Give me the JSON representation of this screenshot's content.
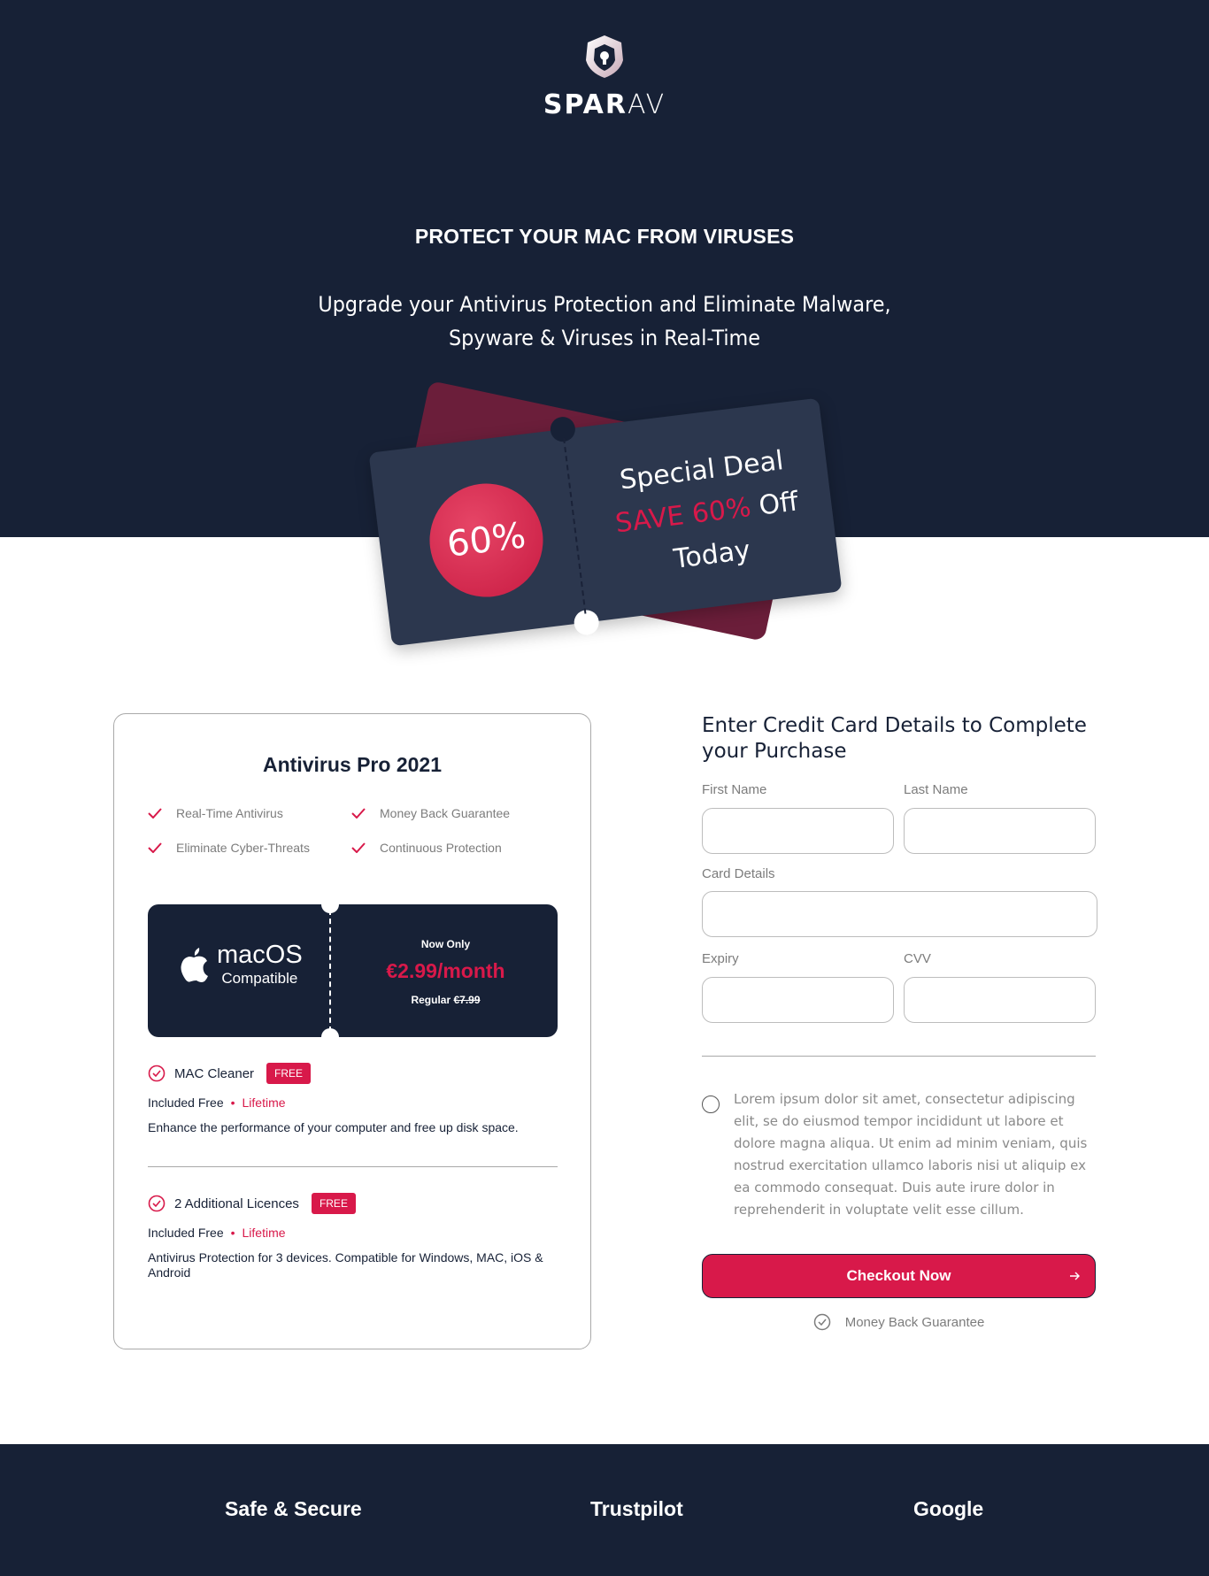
{
  "brand": {
    "name_bold": "SPAR",
    "name_light": "AV",
    "logo_icon": "shield-lock-icon"
  },
  "hero": {
    "headline": "PROTECT YOUR MAC FROM VIRUSES",
    "subhead_line1": "Upgrade your Antivirus Protection and Eliminate Malware,",
    "subhead_line2": "Spyware & Viruses in Real-Time"
  },
  "ticket": {
    "badge": "60%",
    "line1": "Special Deal",
    "save": "SAVE 60%",
    "off": "Off",
    "line3": "Today"
  },
  "product": {
    "title": "Antivirus Pro 2021",
    "features": [
      "Real-Time Antivirus",
      "Money Back Guarantee",
      "Eliminate Cyber-Threats",
      "Continuous Protection"
    ],
    "platform_title": "macOS",
    "platform_sub": "Compatible",
    "price_label": "Now Only",
    "price": "€2.99/month",
    "regular_label": "Regular",
    "regular_price": "€7.99",
    "addons": [
      {
        "name": "MAC Cleaner",
        "badge": "FREE",
        "included": "Included Free",
        "term": "Lifetime",
        "desc": "Enhance the performance of your computer and free up disk space."
      },
      {
        "name": "2 Additional Licences",
        "badge": "FREE",
        "included": "Included Free",
        "term": "Lifetime",
        "desc": "Antivirus Protection for 3 devices. Compatible for Windows, MAC, iOS & Android"
      }
    ]
  },
  "form": {
    "title": "Enter Credit Card Details to Complete your Purchase",
    "first_name": "First Name",
    "last_name": "Last Name",
    "card_details": "Card Details",
    "expiry": "Expiry",
    "cvv": "CVV",
    "terms": "Lorem ipsum dolor sit amet, consectetur adipiscing elit, se do eiusmod tempor incididunt ut labore et dolore magna aliqua. Ut enim ad minim veniam, quis nostrud exercitation ullamco laboris nisi ut aliquip ex ea commodo consequat. Duis aute irure dolor in reprehenderit in voluptate velit esse cillum.",
    "checkout_label": "Checkout Now",
    "guarantee": "Money Back Guarantee"
  },
  "footer": {
    "items": [
      "Safe & Secure",
      "Trustpilot",
      "Google"
    ]
  },
  "colors": {
    "navy": "#172136",
    "accent": "#d8194a",
    "ticket": "#2c374e"
  }
}
